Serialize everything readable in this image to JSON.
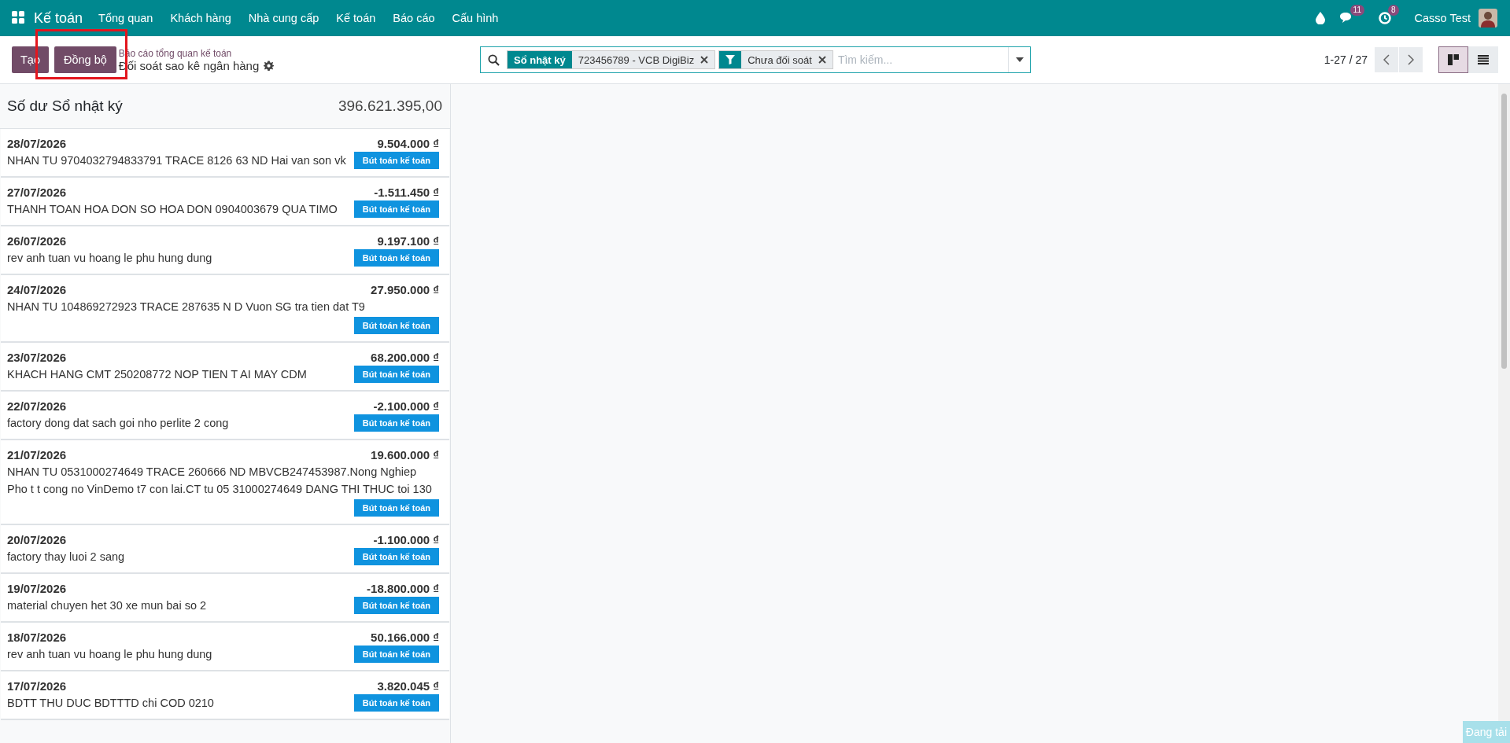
{
  "navbar": {
    "app_name": "Kế toán",
    "menu": [
      "Tổng quan",
      "Khách hàng",
      "Nhà cung cấp",
      "Kế toán",
      "Báo cáo",
      "Cấu hình"
    ],
    "messages_count": "11",
    "activities_count": "8",
    "user_name": "Casso Test"
  },
  "control_panel": {
    "buttons": [
      {
        "label": "Tạo",
        "highlighted": false
      },
      {
        "label": "Đồng bộ",
        "highlighted": true
      }
    ],
    "breadcrumb": "Báo cáo tổng quan kế toán",
    "title": "Đối soát sao kê ngân hàng",
    "facets": [
      {
        "kind": "group",
        "label": "Sổ nhật ký",
        "value": "723456789 - VCB DigiBiz"
      },
      {
        "kind": "filter",
        "value": "Chưa đối soát"
      }
    ],
    "search_placeholder": "Tìm kiếm...",
    "pager": "1-27 / 27",
    "views": [
      {
        "kind": "kanban",
        "selected": true
      },
      {
        "kind": "list",
        "selected": false
      }
    ]
  },
  "balance": {
    "label": "Số dư Sổ nhật ký",
    "amount": "396.621.395,00"
  },
  "transactions": [
    {
      "date": "28/07/2026",
      "amount": "9.504.000 ₫",
      "description": "NHAN TU 9704032794833791 TRACE 8126 63 ND Hai van son vk",
      "action": "Bút toán kế toán"
    },
    {
      "date": "27/07/2026",
      "amount": "-1.511.450 ₫",
      "description": "THANH TOAN HOA DON SO HOA DON 0904003679 QUA TIMO",
      "action": "Bút toán kế toán"
    },
    {
      "date": "26/07/2026",
      "amount": "9.197.100 ₫",
      "description": "rev anh tuan vu hoang le phu hung dung",
      "action": "Bút toán kế toán"
    },
    {
      "date": "24/07/2026",
      "amount": "27.950.000 ₫",
      "description": "NHAN TU 104869272923 TRACE 287635 N D Vuon SG tra tien dat T9",
      "action": "Bút toán kế toán"
    },
    {
      "date": "23/07/2026",
      "amount": "68.200.000 ₫",
      "description": "KHACH HANG CMT 250208772 NOP TIEN T AI MAY CDM",
      "action": "Bút toán kế toán"
    },
    {
      "date": "22/07/2026",
      "amount": "-2.100.000 ₫",
      "description": "factory dong dat sach goi nho perlite 2 cong",
      "action": "Bút toán kế toán"
    },
    {
      "date": "21/07/2026",
      "amount": "19.600.000 ₫",
      "description": "NHAN TU 0531000274649 TRACE 260666 ND MBVCB247453987.Nong Nghiep Pho t t cong no VinDemo t7 con lai.CT tu 05 31000274649 DANG THI THUC toi 130",
      "action": "Bút toán kế toán"
    },
    {
      "date": "20/07/2026",
      "amount": "-1.100.000 ₫",
      "description": "factory thay luoi 2 sang",
      "action": "Bút toán kế toán"
    },
    {
      "date": "19/07/2026",
      "amount": "-18.800.000 ₫",
      "description": "material chuyen het 30 xe mun bai so 2",
      "action": "Bút toán kế toán"
    },
    {
      "date": "18/07/2026",
      "amount": "50.166.000 ₫",
      "description": "rev anh tuan vu hoang le phu hung dung",
      "action": "Bút toán kế toán"
    },
    {
      "date": "17/07/2026",
      "amount": "3.820.045 ₫",
      "description": "BDTT THU DUC BDTTTD chi COD 0210",
      "action": "Bút toán kế toán"
    }
  ],
  "loading_label": "Đang tải"
}
